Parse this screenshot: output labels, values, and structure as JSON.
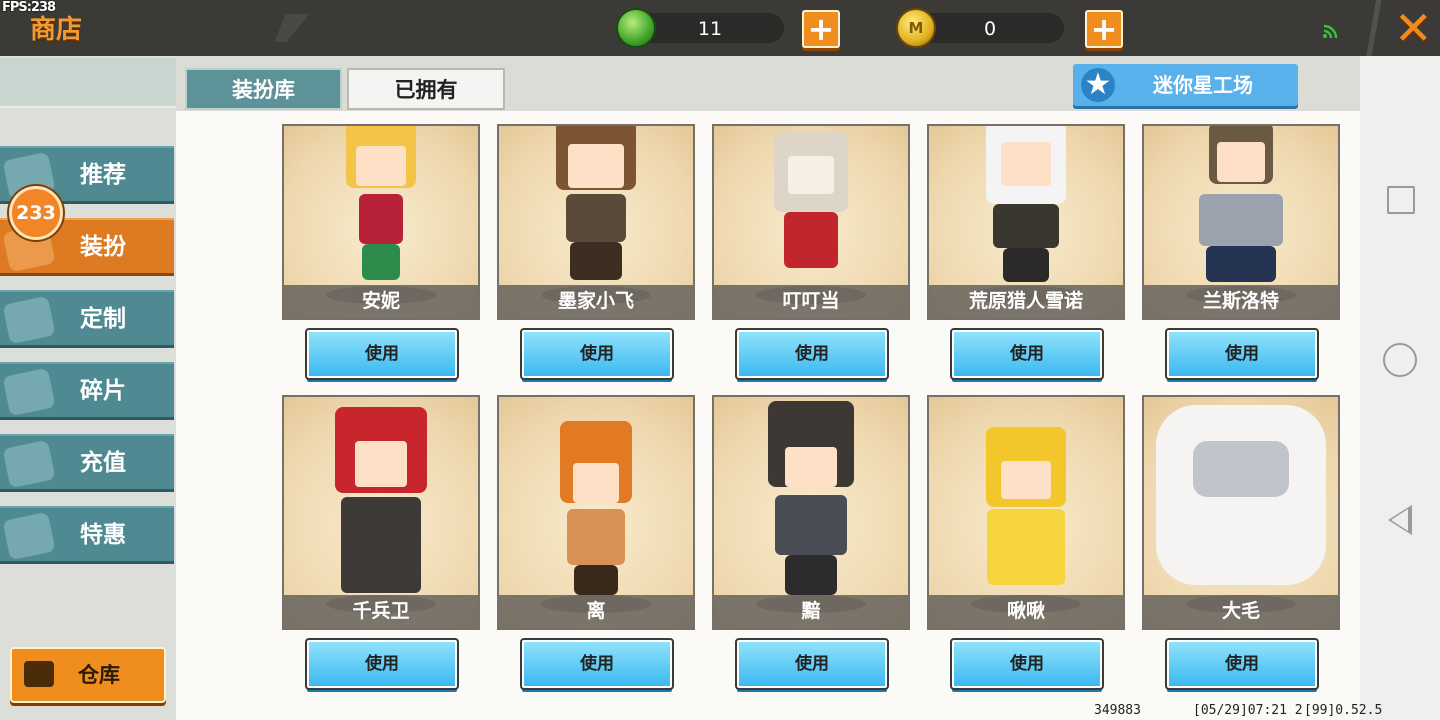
{
  "status": {
    "fps": "FPS:238"
  },
  "header": {
    "title": "商店",
    "currency_green": "11",
    "currency_gold": "0",
    "gold_symbol": "M",
    "plus": "+",
    "close": "✕"
  },
  "sidebar": {
    "badge": "233",
    "items": [
      {
        "label": "推荐"
      },
      {
        "label": "装扮"
      },
      {
        "label": "定制"
      },
      {
        "label": "碎片"
      },
      {
        "label": "充值"
      },
      {
        "label": "特惠"
      }
    ],
    "warehouse": "仓库"
  },
  "tabs": [
    {
      "label": "装扮库"
    },
    {
      "label": "已拥有"
    }
  ],
  "studio_button": "迷你星工场",
  "use_label": "使用",
  "cards": [
    {
      "name": "安妮"
    },
    {
      "name": "墨家小飞"
    },
    {
      "name": "叮叮当"
    },
    {
      "name": "荒原猎人雪诺"
    },
    {
      "name": "兰斯洛特"
    },
    {
      "name": "千兵卫"
    },
    {
      "name": "离"
    },
    {
      "name": "黯"
    },
    {
      "name": "啾啾"
    },
    {
      "name": "大毛"
    }
  ],
  "footer": {
    "id": "349883",
    "time": "[05/29]07:21 2",
    "version": "[99]0.52.5"
  },
  "colors": {
    "accent_orange": "#f08d1f",
    "sidebar_teal": "#4f8a93",
    "use_button_blue": "#3cb9f0"
  }
}
